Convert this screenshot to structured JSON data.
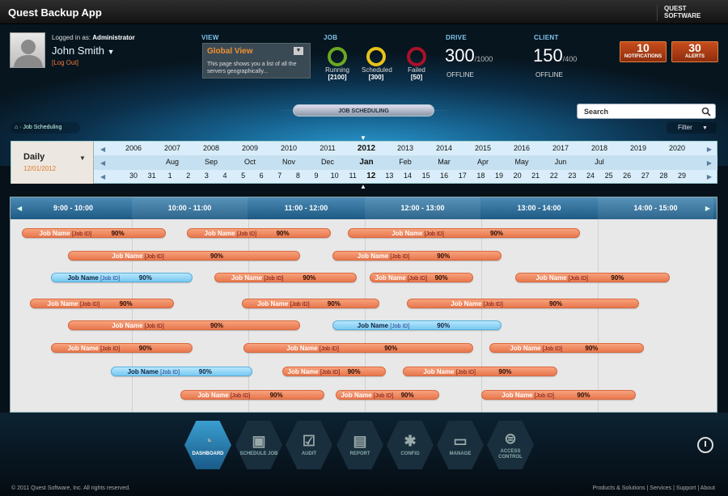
{
  "app": {
    "title": "Quest Backup App",
    "brand": "QUEST SOFTWARE"
  },
  "user": {
    "logged_in_label": "Logged in as:",
    "role": "Administrator",
    "name": "John Smith",
    "logout": "[Log Out]"
  },
  "view": {
    "label": "VIEW",
    "title": "Global View",
    "description": "This page shows you a list of all the servers geographically..."
  },
  "job": {
    "label": "JOB",
    "stats": [
      {
        "label": "Running",
        "count": "[2100]",
        "color": "#6aa820"
      },
      {
        "label": "Scheduled",
        "count": "[300]",
        "color": "#e8c21a"
      },
      {
        "label": "Failed",
        "count": "[50]",
        "color": "#a8122a"
      }
    ]
  },
  "drive": {
    "label": "DRIVE",
    "value": "300",
    "total": "/1000",
    "status": "OFFLINE"
  },
  "client": {
    "label": "CLIENT",
    "value": "150",
    "total": "/400",
    "status": "OFFLINE"
  },
  "notifications": {
    "count": "10",
    "label": "NOTIFICATIONS"
  },
  "alerts": {
    "count": "30",
    "label": "ALERTS"
  },
  "section": {
    "title": "JOB SCHEDULING",
    "breadcrumb": "Job Scheduling"
  },
  "search": {
    "placeholder": "Search"
  },
  "filter": {
    "label": "Filter"
  },
  "timeline": {
    "mode": "Daily",
    "date": "12/01/2012",
    "years": [
      "2006",
      "2007",
      "2008",
      "2009",
      "2010",
      "2011",
      "2012",
      "2013",
      "2014",
      "2015",
      "2016",
      "2017",
      "2018",
      "2019",
      "2020"
    ],
    "months": [
      "Aug",
      "Sep",
      "Oct",
      "Nov",
      "Dec",
      "Jan",
      "Feb",
      "Mar",
      "Apr",
      "May",
      "Jun",
      "Jul"
    ],
    "days": [
      "30",
      "31",
      "1",
      "2",
      "3",
      "4",
      "5",
      "6",
      "7",
      "8",
      "9",
      "10",
      "11",
      "12",
      "13",
      "14",
      "15",
      "16",
      "17",
      "18",
      "19",
      "20",
      "21",
      "22",
      "23",
      "24",
      "25",
      "26",
      "27",
      "28",
      "29"
    ]
  },
  "hours": [
    "9:00 - 10:00",
    "10:00 - 11:00",
    "11:00 - 12:00",
    "12:00 - 13:00",
    "13:00 - 14:00",
    "14:00 - 15:00"
  ],
  "job_template": {
    "name": "Job Name",
    "id": "[Job ID]",
    "percent": "90%"
  },
  "nav": [
    {
      "label": "DASHBOARD",
      "icon": "dashboard-icon"
    },
    {
      "label": "SCHEDULE JOB",
      "icon": "calendar-icon"
    },
    {
      "label": "AUDIT",
      "icon": "checkbox-icon"
    },
    {
      "label": "REPORT",
      "icon": "document-icon"
    },
    {
      "label": "CONFIG",
      "icon": "gear-icon"
    },
    {
      "label": "MANAGE",
      "icon": "folder-icon"
    },
    {
      "label": "ACCESS CONTROL",
      "icon": "access-icon"
    }
  ],
  "footer": {
    "copyright": "© 2011 Quest Software, Inc. All rights reserved.",
    "links": [
      "Products & Solutions",
      "Services",
      "Support",
      "About"
    ]
  }
}
